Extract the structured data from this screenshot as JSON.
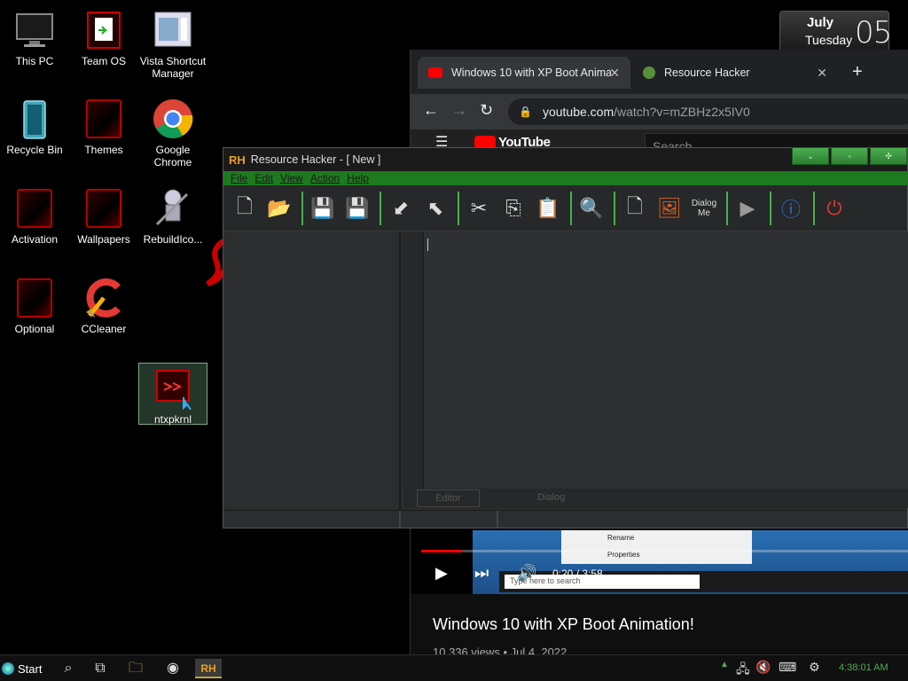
{
  "desktop": {
    "icons": [
      {
        "label": "This PC"
      },
      {
        "label": "Team OS"
      },
      {
        "label": "Vista Shortcut Manager"
      },
      {
        "label": "Recycle Bin"
      },
      {
        "label": "Themes"
      },
      {
        "label": "Google Chrome"
      },
      {
        "label": "Activation"
      },
      {
        "label": "Wallpapers"
      },
      {
        "label": "RebuildIco..."
      },
      {
        "label": "Optional"
      },
      {
        "label": "CCleaner"
      },
      {
        "label": "ntxpkrnl"
      }
    ]
  },
  "clock_widget": {
    "month": "July",
    "weekday": "Tuesday",
    "day": "05"
  },
  "browser": {
    "tabs": [
      {
        "label": "Windows 10 with XP Boot Anima"
      },
      {
        "label": "Resource Hacker"
      }
    ],
    "new_tab": "+",
    "url_host": "youtube.com",
    "url_path": "/watch?v=mZBHz2x5IV0",
    "yt_logo": "YouTube",
    "yt_search_placeholder": "Search",
    "video": {
      "menu_items": [
        "Rename",
        "Properties"
      ],
      "taskbar_search": "Type here to search",
      "time": "0:20 / 3:58",
      "progress": 0.0837
    },
    "video_title": "Windows 10 with XP Boot Animation!",
    "video_meta": "10,336 views • Jul 4, 2022"
  },
  "resource_hacker": {
    "logo": "RH",
    "title": "Resource Hacker - [ New ]",
    "menu": [
      "File",
      "Edit",
      "View",
      "Action",
      "Help"
    ],
    "toolbar_dialog_label": "Dialog Me",
    "editor_tabs": [
      "Editor",
      "Dialog"
    ]
  },
  "taskbar": {
    "start_label": "Start",
    "pinned_rh": "RH",
    "time": "4:38:01 AM"
  },
  "colors": {
    "accent_green": "#4caf50",
    "youtube_red": "#ff0000",
    "rh_orange": "#e8a020"
  }
}
